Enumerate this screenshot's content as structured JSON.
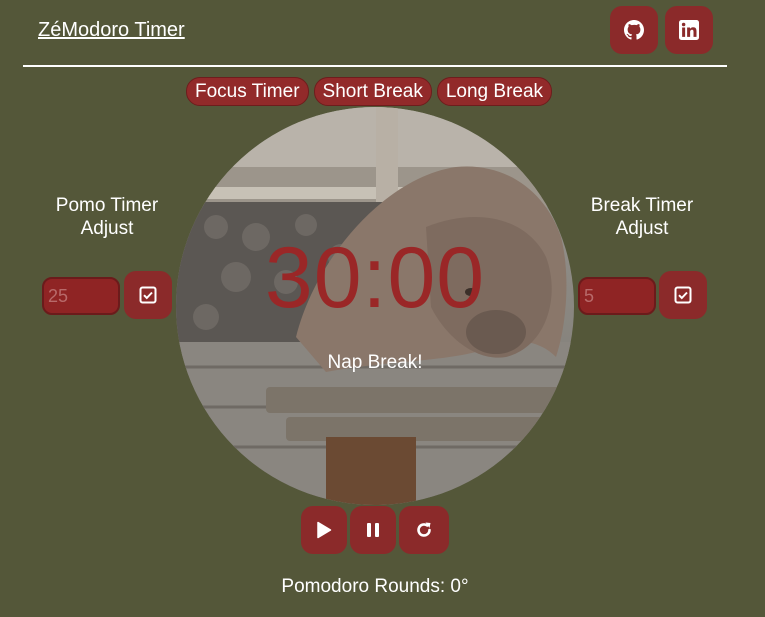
{
  "header": {
    "title": "ZéModoro Timer",
    "github_icon": "github-icon",
    "linkedin_icon": "linkedin-icon"
  },
  "modes": [
    {
      "label": "Focus Timer"
    },
    {
      "label": "Short Break"
    },
    {
      "label": "Long Break"
    }
  ],
  "pomo_adjust": {
    "title_line1": "Pomo Timer",
    "title_line2": "Adjust",
    "placeholder": "25",
    "confirm_icon": "checkbox-icon"
  },
  "break_adjust": {
    "title_line1": "Break Timer",
    "title_line2": "Adjust",
    "placeholder": "5",
    "confirm_icon": "checkbox-icon"
  },
  "timer": {
    "display": "30:00",
    "status": "Nap Break!",
    "image": "sleeping-sea-lion-on-bench"
  },
  "controls": {
    "play_icon": "play-icon",
    "pause_icon": "pause-icon",
    "reset_icon": "reset-icon"
  },
  "rounds": {
    "label": "Pomodoro Rounds: 0°"
  },
  "colors": {
    "background": "#545739",
    "accent": "#8b2a2a",
    "timer_text": "#9a2727"
  }
}
